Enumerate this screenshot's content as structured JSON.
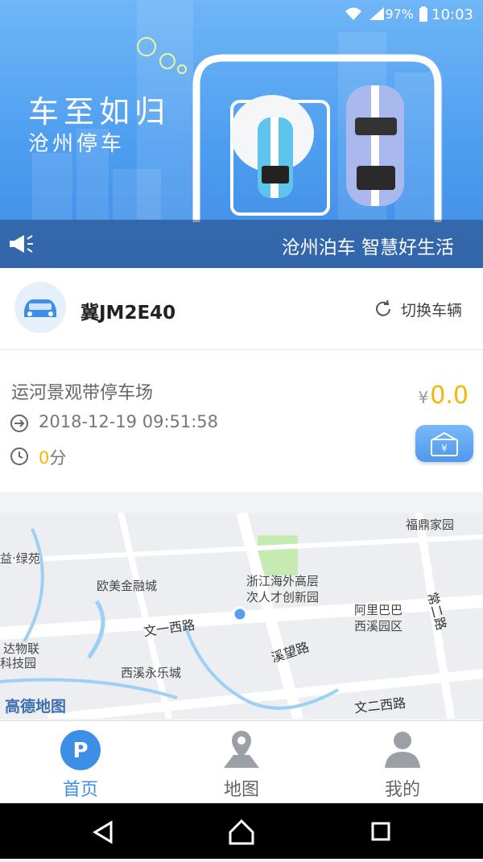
{
  "status_bar": {
    "battery": "97%",
    "time": "10:03"
  },
  "banner": {
    "slogan_main": "车至如归",
    "slogan_sub": "沧州停车",
    "ticker": "沧州泊车 智慧好生活"
  },
  "vehicle": {
    "plate": "冀JM2E40",
    "switch_label": "切换车辆"
  },
  "parking": {
    "lot_name": "运河景观带停车场",
    "entry_time": "2018-12-19 09:51:58",
    "duration_value": "0",
    "duration_unit": "分",
    "currency": "¥",
    "fee": "0.0"
  },
  "map": {
    "labels": {
      "fuding": "福鼎家园",
      "lvyuan": "益·绿苑",
      "oumei": "欧美金融城",
      "zhejiang1": "浙江海外高层",
      "zhejiang2": "次人才创新园",
      "alibaba1": "阿里巴巴",
      "alibaba2": "西溪园区",
      "wuliu1": "达物联",
      "wuliu2": "科技园",
      "yongle": "西溪永乐城",
      "wenyi": "文一西路",
      "xiwang": "溪望路",
      "changer": "常二路",
      "wener": "文二西路",
      "logo": "高德地图"
    }
  },
  "tabs": [
    {
      "label": "首页",
      "active": true
    },
    {
      "label": "地图",
      "active": false
    },
    {
      "label": "我的",
      "active": false
    }
  ],
  "colors": {
    "accent": "#3d8ee6",
    "fee": "#f2b705",
    "inactive": "#9aa0a6"
  }
}
